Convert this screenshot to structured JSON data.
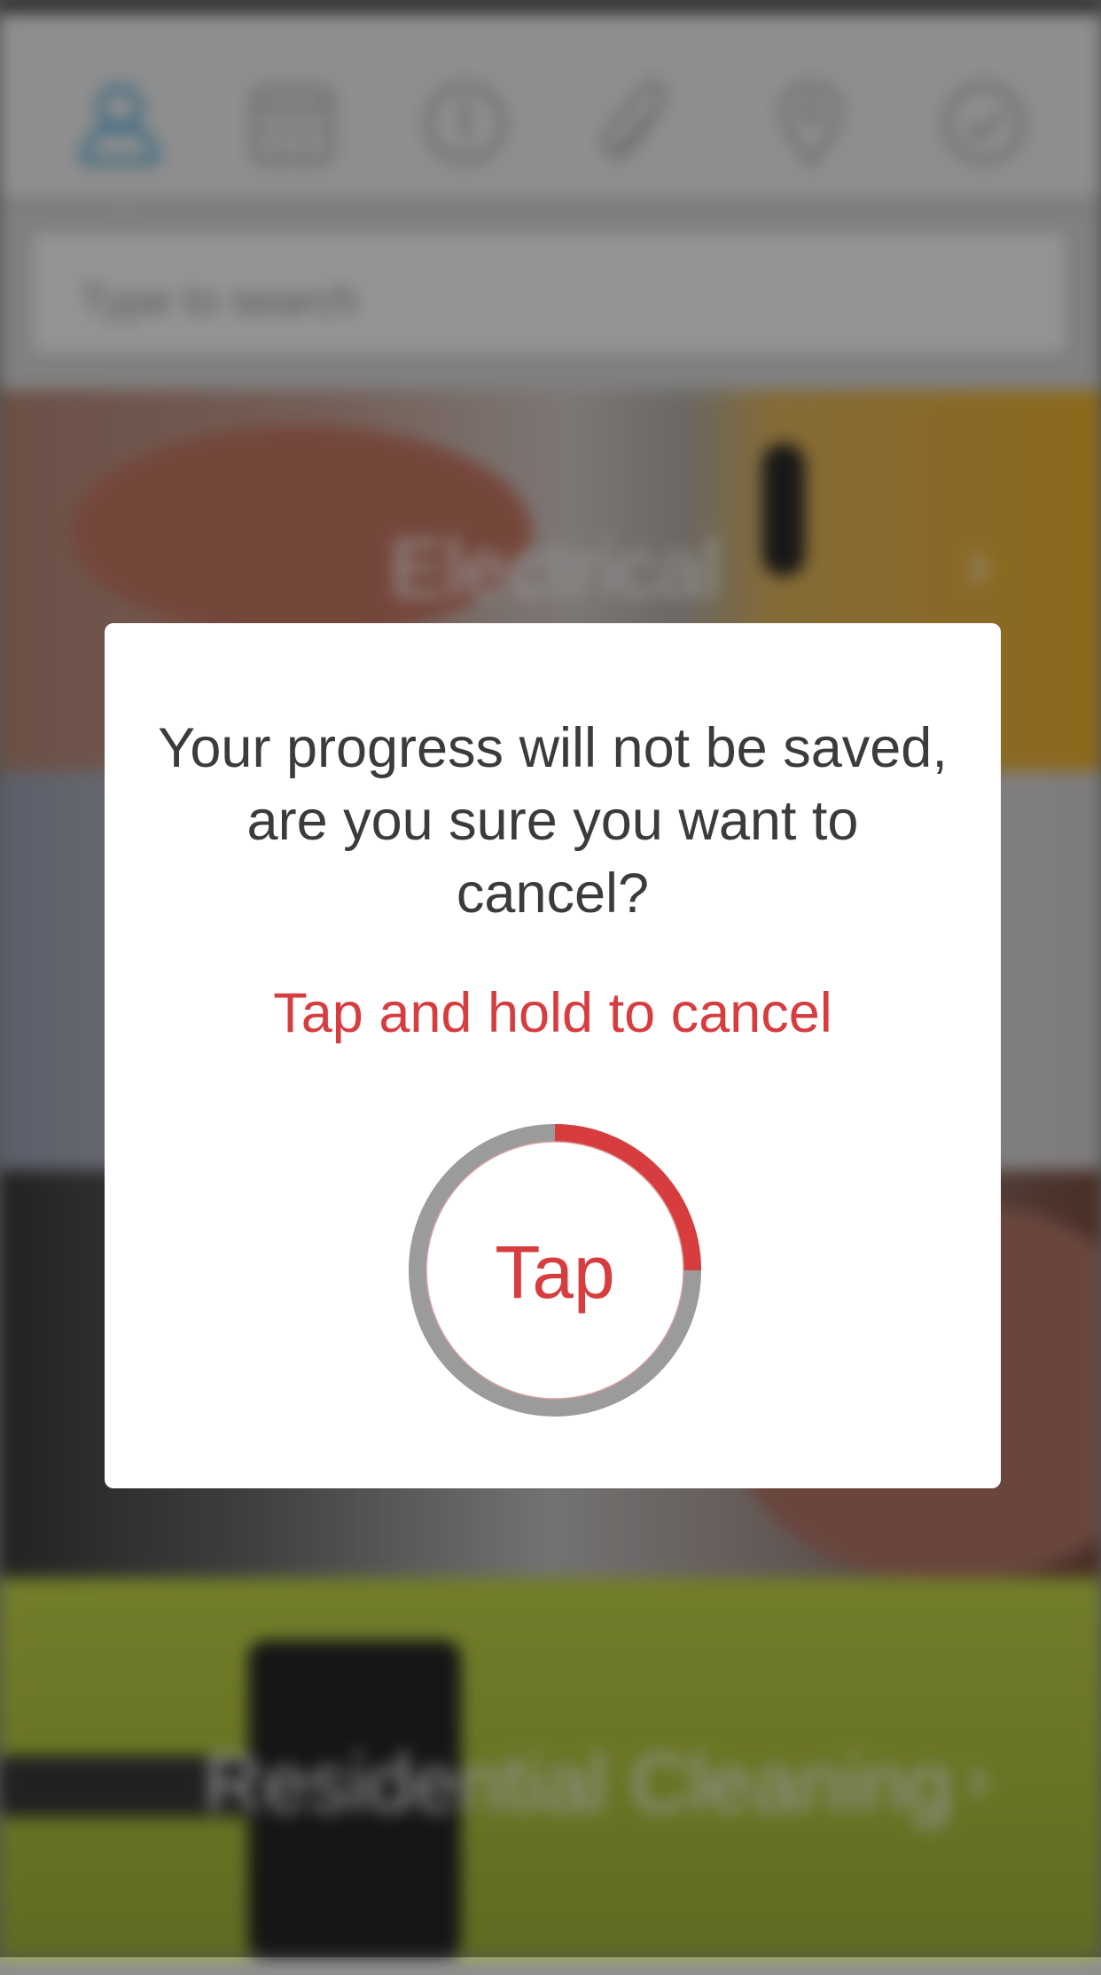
{
  "colors": {
    "accent_red": "#d73d3f",
    "text_dark": "#3b3b3b",
    "ring_gray": "#9b9b9b",
    "tab_active_blue": "#3aa0d8",
    "tab_inactive_gray": "#b0b0b0"
  },
  "tabs": [
    {
      "icon": "person-icon",
      "active": true
    },
    {
      "icon": "calendar-icon",
      "active": false
    },
    {
      "icon": "info-icon",
      "active": false
    },
    {
      "icon": "paperclip-icon",
      "active": false
    },
    {
      "icon": "location-pin-icon",
      "active": false
    },
    {
      "icon": "checkmark-icon",
      "active": false
    }
  ],
  "search": {
    "placeholder": "Type to search"
  },
  "categories": [
    {
      "title": "Electrical",
      "chevron": "›"
    },
    {
      "title": "Residential Cleaning",
      "chevron": "›"
    }
  ],
  "modal": {
    "message": "Your progress will not be saved, are you sure you want to cancel?",
    "hint": "Tap and hold to cancel",
    "tap_label": "Tap",
    "progress": 0.25
  }
}
